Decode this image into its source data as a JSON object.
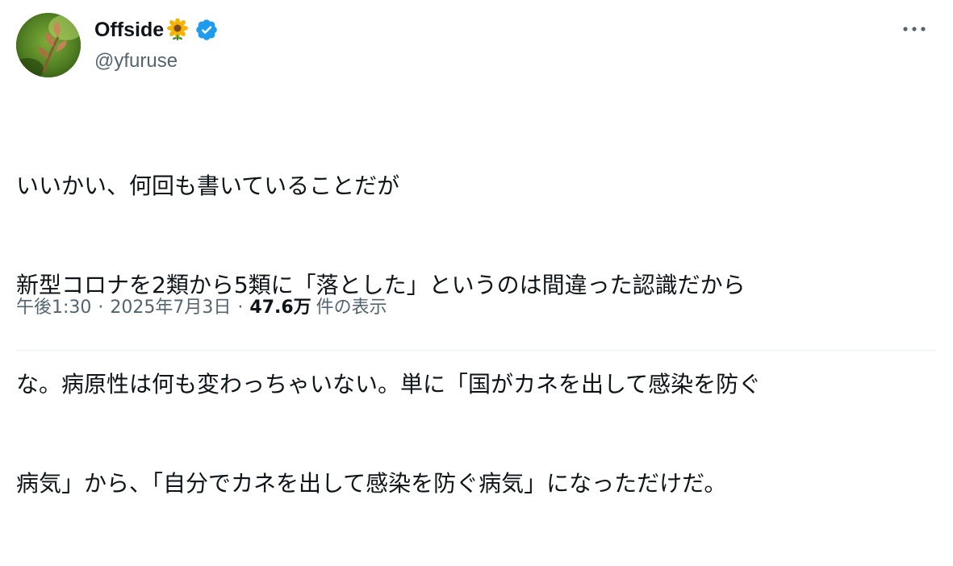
{
  "user": {
    "display_name": "Offside",
    "name_emoji_icon": "sunflower-icon",
    "verified_icon": "verified-badge-icon",
    "handle": "@yfuruse",
    "avatar_icon": "avatar-plant-photo"
  },
  "actions": {
    "more_icon": "more-horizontal-icon"
  },
  "tweet": {
    "lines": [
      "いいかい、何回も書いていることだが",
      "新型コロナを2類から5類に「落とした」というのは間違った認識だから",
      "な。病原性は何も変わっちゃいない。単に「国がカネを出して感染を防ぐ",
      "病気」から、「自分でカネを出して感染を防ぐ病気」になっただけだ。"
    ]
  },
  "meta": {
    "time": "午後1:30",
    "separator": "·",
    "date": "2025年7月3日",
    "views_count": "47.6万",
    "views_label": "件の表示"
  },
  "colors": {
    "text_primary": "#0f1419",
    "text_secondary": "#536471",
    "verified_blue": "#1d9bf0",
    "divider": "#eff3f4"
  }
}
